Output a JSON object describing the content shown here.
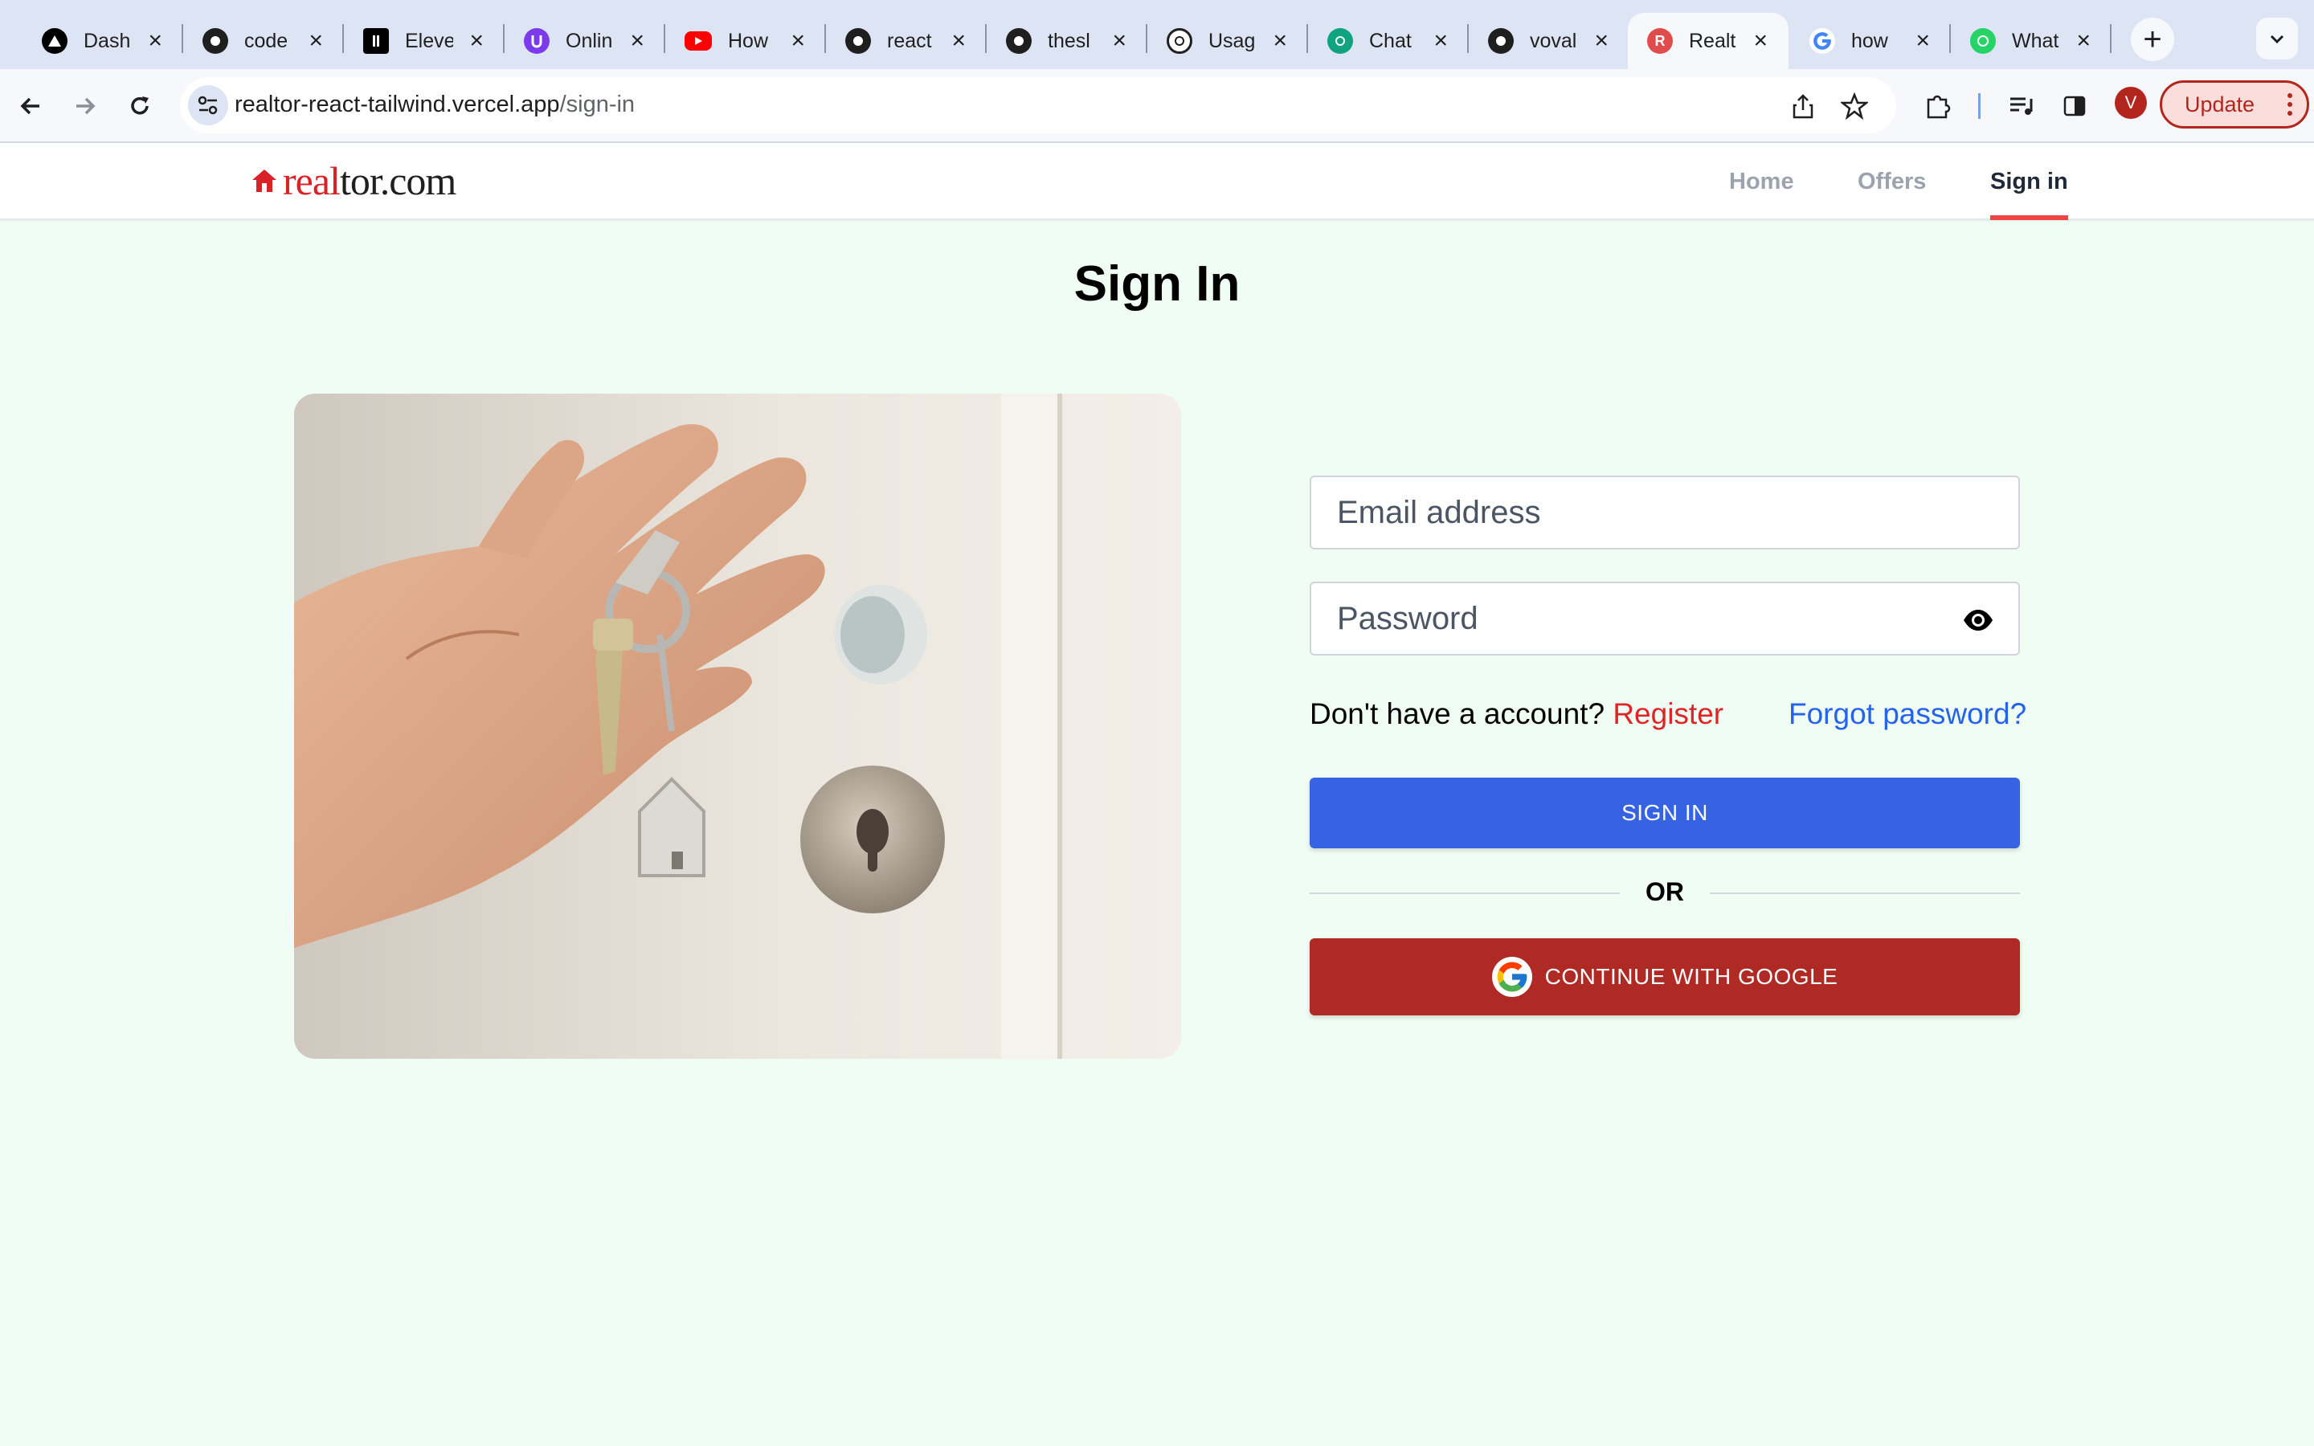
{
  "browser": {
    "tabs": [
      {
        "label": "Dash",
        "icon": "triangle-logo-icon",
        "color": "#000000"
      },
      {
        "label": "code",
        "icon": "github-icon",
        "color": "#1f1f1f"
      },
      {
        "label": "Eleve",
        "icon": "elevenlabs-icon",
        "color": "#000000"
      },
      {
        "label": "Onlin",
        "icon": "purple-logo-icon",
        "color": "#7c3aed"
      },
      {
        "label": "How",
        "icon": "youtube-icon",
        "color": "#ff0000"
      },
      {
        "label": "react",
        "icon": "github-icon",
        "color": "#1f1f1f"
      },
      {
        "label": "thesl",
        "icon": "github-icon",
        "color": "#1f1f1f"
      },
      {
        "label": "Usag",
        "icon": "openai-icon",
        "color": "#1f1f1f"
      },
      {
        "label": "Chat",
        "icon": "chatgpt-icon",
        "color": "#10a37f"
      },
      {
        "label": "voval",
        "icon": "github-icon",
        "color": "#1f1f1f"
      },
      {
        "label": "Realt",
        "icon": "realtor-r-icon",
        "color": "#e04b4b"
      },
      {
        "label": "how",
        "icon": "google-icon",
        "color": "#4285f4"
      },
      {
        "label": "What",
        "icon": "whatsapp-icon",
        "color": "#25d366"
      }
    ],
    "url_host": "realtor-react-tailwind.vercel.app",
    "url_path": "/sign-in",
    "avatar_letter": "V",
    "update_label": "Update"
  },
  "site": {
    "logo_red": "real",
    "logo_black": "tor.com",
    "nav": [
      "Home",
      "Offers",
      "Sign in"
    ],
    "active_nav": "Sign in",
    "brand_color": "#d92228"
  },
  "form": {
    "title": "Sign In",
    "email_placeholder": "Email address",
    "password_placeholder": "Password",
    "no_account_text": "Don't have a account?",
    "register_label": "Register",
    "forgot_label": "Forgot password?",
    "signin_label": "SIGN IN",
    "or_label": "OR",
    "google_label": "CONTINUE WITH GOOGLE",
    "signin_color": "#3563e2",
    "google_color": "#b02a25"
  }
}
